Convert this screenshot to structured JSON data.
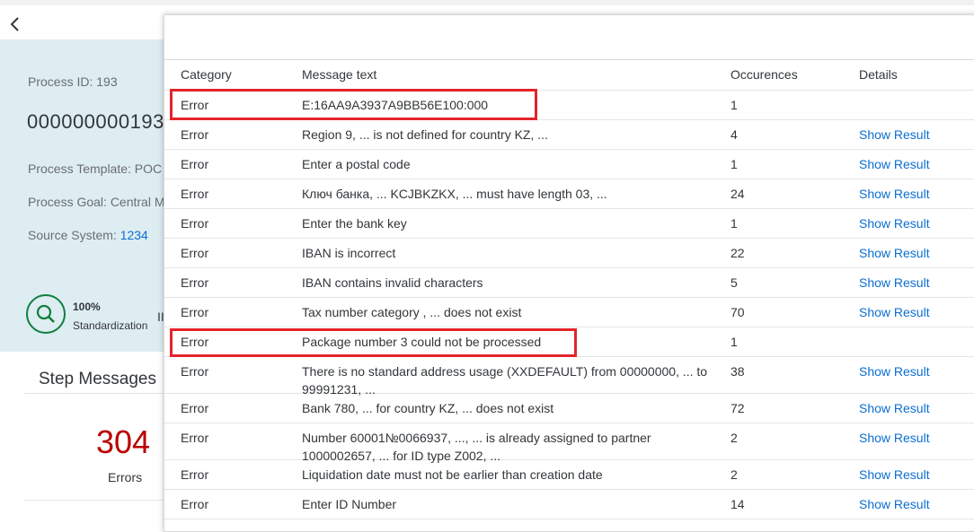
{
  "page": {
    "process_id_label": "Process ID: 193",
    "process_id_big": "000000000193",
    "template_label": "Process Template: POC",
    "goal_label": "Process Goal: Central M",
    "source_label": "Source System: ",
    "source_value": "1234",
    "progress_pct": "100%",
    "progress_label": "Standardization",
    "bars": "II",
    "step_title": "Step Messages",
    "error_count": "304",
    "error_label": "Errors"
  },
  "table": {
    "headers": {
      "category": "Category",
      "message": "Message text",
      "occurrences": "Occurences",
      "details": "Details"
    },
    "rows": [
      {
        "category": "Error",
        "message": "E:16AA9A3937A9BB56E100:000",
        "occurrences": "1",
        "details": ""
      },
      {
        "category": "Error",
        "message": "Region 9, ... is not defined for country KZ, ...",
        "occurrences": "4",
        "details": "Show Result"
      },
      {
        "category": "Error",
        "message": "Enter a postal code",
        "occurrences": "1",
        "details": "Show Result"
      },
      {
        "category": "Error",
        "message": "Ключ банка, ... KCJBKZKX, ... must have length 03, ...",
        "occurrences": "24",
        "details": "Show Result"
      },
      {
        "category": "Error",
        "message": "Enter the bank key",
        "occurrences": "1",
        "details": "Show Result"
      },
      {
        "category": "Error",
        "message": "IBAN is incorrect",
        "occurrences": "22",
        "details": "Show Result"
      },
      {
        "category": "Error",
        "message": "IBAN contains invalid characters",
        "occurrences": "5",
        "details": "Show Result"
      },
      {
        "category": "Error",
        "message": "Tax number category , ... does not exist",
        "occurrences": "70",
        "details": "Show Result"
      },
      {
        "category": "Error",
        "message": "Package number 3 could not be processed",
        "occurrences": "1",
        "details": ""
      },
      {
        "category": "Error",
        "message": "There is no standard address usage (XXDEFAULT) from 00000000, ... to 99991231, ...",
        "occurrences": "38",
        "details": "Show Result"
      },
      {
        "category": "Error",
        "message": "Bank 780, ... for country KZ, ... does not exist",
        "occurrences": "72",
        "details": "Show Result"
      },
      {
        "category": "Error",
        "message": "Number 60001№0066937, ..., ... is already assigned to partner 1000002657, ... for ID type Z002, ...",
        "occurrences": "2",
        "details": "Show Result"
      },
      {
        "category": "Error",
        "message": "Liquidation date must not be earlier than creation date",
        "occurrences": "2",
        "details": "Show Result"
      },
      {
        "category": "Error",
        "message": "Enter ID Number",
        "occurrences": "14",
        "details": "Show Result"
      }
    ]
  },
  "icons": {
    "back": "chevron-left-icon",
    "search": "search-icon"
  },
  "colors": {
    "accent": "#0a6ed1",
    "error": "#bb0000",
    "highlight": "#e3242b",
    "success": "#107e3e"
  }
}
